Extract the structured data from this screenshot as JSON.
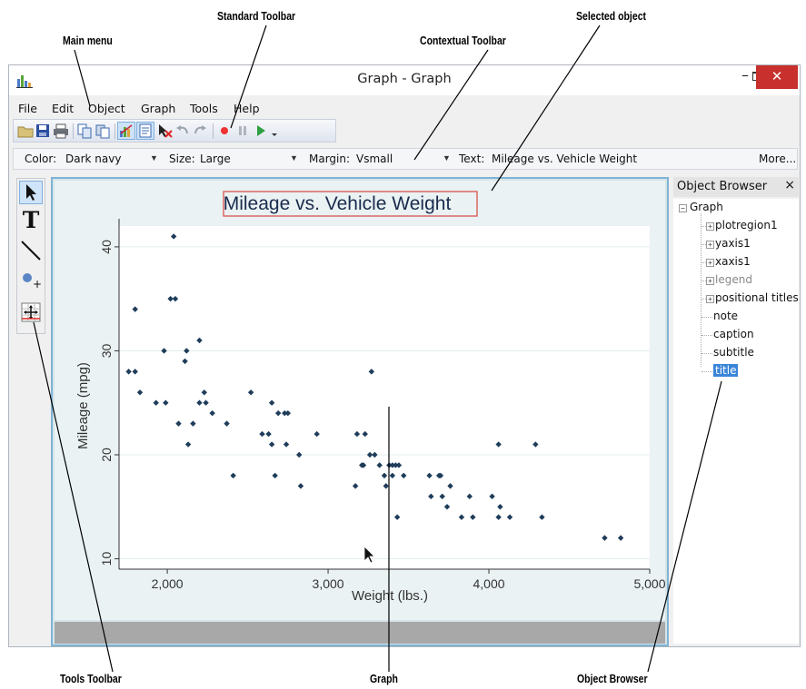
{
  "callouts": {
    "main_menu": "Main menu",
    "standard_toolbar": "Standard Toolbar",
    "contextual_toolbar": "Contextual Toolbar",
    "selected_object": "Selected object",
    "tools_toolbar": "Tools Toolbar",
    "graph": "Graph",
    "object_browser": "Object Browser"
  },
  "window": {
    "title": "Graph - Graph",
    "icon": "bar-chart-icon",
    "controls": {
      "minimize": "–",
      "close": "✕"
    }
  },
  "menu": [
    "File",
    "Edit",
    "Object",
    "Graph",
    "Tools",
    "Help"
  ],
  "standard_toolbar": {
    "icons": [
      "open-icon",
      "save-icon",
      "print-icon",
      "copy-icon",
      "copy-alt-icon",
      "graph-editor-icon",
      "browser-icon",
      "pointer-delete-icon",
      "undo-icon",
      "redo-icon",
      "record-icon",
      "pause-icon",
      "play-icon",
      "overflow-icon"
    ]
  },
  "contextual_toolbar": {
    "color_label": "Color:",
    "color_value": "Dark navy",
    "size_label": "Size:",
    "size_value": "Large",
    "margin_label": "Margin:",
    "margin_value": "Vsmall",
    "text_label": "Text:",
    "text_value": "Mileage vs. Vehicle Weight",
    "more": "More..."
  },
  "tools_toolbar": {
    "tools": [
      "pointer-icon",
      "text-tool-icon",
      "line-tool-icon",
      "marker-tool-icon",
      "grid-editor-icon"
    ],
    "text_tool_glyph": "T",
    "marker_plus": "+"
  },
  "object_browser": {
    "title": "Object Browser",
    "close": "×",
    "root": "Graph",
    "expander_open": "−",
    "expander_closed": "+",
    "nodes": [
      {
        "label": "plotregion1",
        "expandable": true
      },
      {
        "label": "yaxis1",
        "expandable": true
      },
      {
        "label": "xaxis1",
        "expandable": true
      },
      {
        "label": "legend",
        "expandable": true,
        "dim": true
      },
      {
        "label": "positional titles",
        "expandable": true
      },
      {
        "label": "note",
        "expandable": false
      },
      {
        "label": "caption",
        "expandable": false
      },
      {
        "label": "subtitle",
        "expandable": false
      },
      {
        "label": "title",
        "expandable": false,
        "selected": true
      }
    ]
  },
  "colors": {
    "accent": "#3a85d8",
    "marker": "#1f3d5a",
    "title_text": "#1a2c4e",
    "selection_box": "#d9534f",
    "close_button": "#c7302c"
  },
  "chart_data": {
    "type": "scatter",
    "title": "Mileage vs. Vehicle Weight",
    "xlabel": "Weight (lbs.)",
    "ylabel": "Mileage (mpg)",
    "xlim": [
      1700,
      5000
    ],
    "ylim": [
      9,
      42
    ],
    "xticks": [
      2000,
      3000,
      4000,
      5000
    ],
    "xtick_labels": [
      "2,000",
      "3,000",
      "4,000",
      "5,000"
    ],
    "yticks": [
      10,
      20,
      30,
      40
    ],
    "ytick_labels": [
      "10",
      "20",
      "30",
      "40"
    ],
    "grid": true,
    "points": [
      [
        1760,
        28
      ],
      [
        1800,
        28
      ],
      [
        1800,
        34
      ],
      [
        1830,
        26
      ],
      [
        1930,
        25
      ],
      [
        1980,
        30
      ],
      [
        1990,
        25
      ],
      [
        2020,
        35
      ],
      [
        2040,
        41
      ],
      [
        2050,
        35
      ],
      [
        2070,
        23
      ],
      [
        2110,
        29
      ],
      [
        2120,
        30
      ],
      [
        2130,
        21
      ],
      [
        2160,
        23
      ],
      [
        2200,
        31
      ],
      [
        2200,
        25
      ],
      [
        2230,
        26
      ],
      [
        2240,
        25
      ],
      [
        2280,
        24
      ],
      [
        2370,
        23
      ],
      [
        2410,
        18
      ],
      [
        2520,
        26
      ],
      [
        2590,
        22
      ],
      [
        2630,
        22
      ],
      [
        2650,
        25
      ],
      [
        2650,
        21
      ],
      [
        2670,
        18
      ],
      [
        2690,
        24
      ],
      [
        2730,
        24
      ],
      [
        2740,
        21
      ],
      [
        2750,
        24
      ],
      [
        2820,
        20
      ],
      [
        2830,
        17
      ],
      [
        2930,
        22
      ],
      [
        3170,
        17
      ],
      [
        3180,
        22
      ],
      [
        3210,
        19
      ],
      [
        3220,
        19
      ],
      [
        3230,
        22
      ],
      [
        3260,
        20
      ],
      [
        3270,
        28
      ],
      [
        3290,
        20
      ],
      [
        3320,
        19
      ],
      [
        3350,
        18
      ],
      [
        3360,
        17
      ],
      [
        3380,
        19
      ],
      [
        3400,
        18
      ],
      [
        3400,
        19
      ],
      [
        3420,
        19
      ],
      [
        3430,
        14
      ],
      [
        3440,
        19
      ],
      [
        3470,
        18
      ],
      [
        3630,
        18
      ],
      [
        3640,
        16
      ],
      [
        3690,
        18
      ],
      [
        3700,
        18
      ],
      [
        3710,
        16
      ],
      [
        3740,
        15
      ],
      [
        3760,
        17
      ],
      [
        3830,
        14
      ],
      [
        3880,
        16
      ],
      [
        3900,
        14
      ],
      [
        4020,
        16
      ],
      [
        4060,
        21
      ],
      [
        4070,
        15
      ],
      [
        4060,
        14
      ],
      [
        4130,
        14
      ],
      [
        4290,
        21
      ],
      [
        4330,
        14
      ],
      [
        4720,
        12
      ],
      [
        4820,
        12
      ]
    ]
  }
}
